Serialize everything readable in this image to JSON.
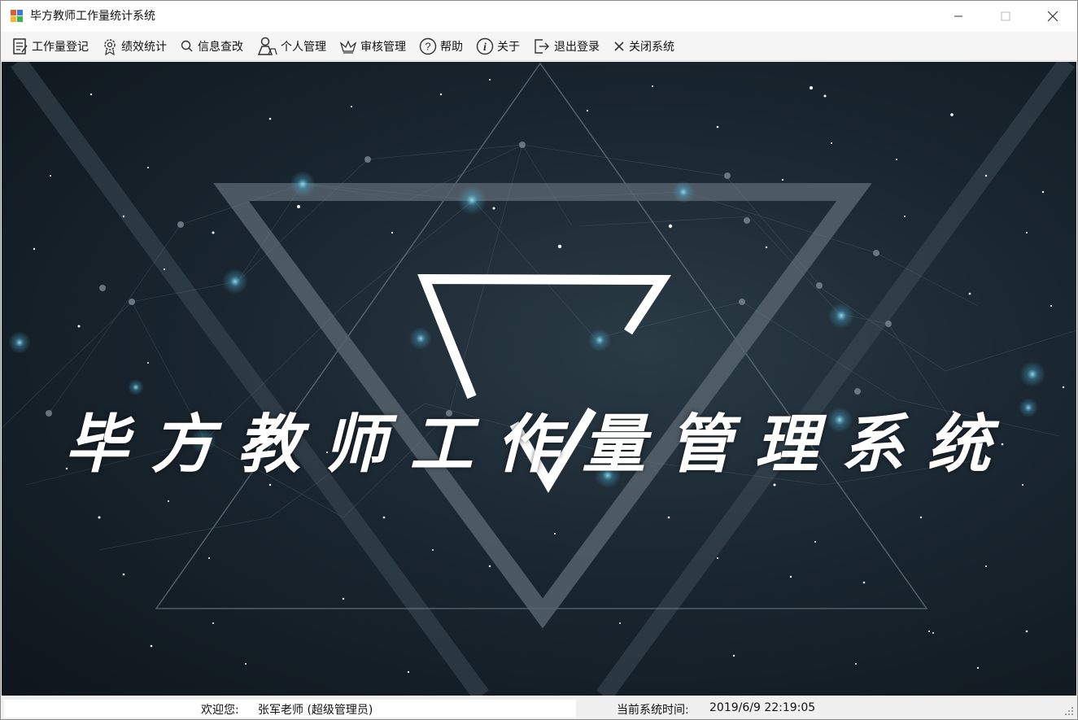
{
  "window": {
    "title": "毕方教师工作量统计系统",
    "controls": {
      "minimize": "–",
      "maximize": "☐",
      "close": "✕"
    }
  },
  "menu": [
    {
      "label": "工作量登记",
      "icon": "notepad-icon"
    },
    {
      "label": "绩效统计",
      "icon": "gear-icon"
    },
    {
      "label": "信息查改",
      "icon": "search-icon"
    },
    {
      "label": "个人管理",
      "icon": "users-icon"
    },
    {
      "label": "审核管理",
      "icon": "crown-icon"
    },
    {
      "label": "帮助",
      "icon": "help-icon"
    },
    {
      "label": "关于",
      "icon": "info-icon"
    },
    {
      "label": "退出登录",
      "icon": "logout-icon"
    },
    {
      "label": "关闭系统",
      "icon": "close-icon"
    }
  ],
  "banner": {
    "headline": "毕方教师工作量管理系统"
  },
  "status": {
    "welcome_label": "欢迎您:",
    "user": "张军老师  (超级管理员)",
    "time_label": "当前系统时间:",
    "time": "2019/6/9 22:19:05"
  }
}
